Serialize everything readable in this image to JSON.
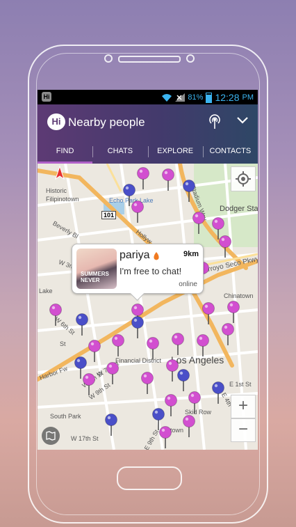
{
  "status_bar": {
    "app_badge": "Hi",
    "battery_percent": "81%",
    "time": "12:28",
    "ampm": "PM"
  },
  "app_bar": {
    "logo_text": "Hi",
    "title": "Nearby people"
  },
  "tabs": [
    {
      "label": "FIND",
      "active": true
    },
    {
      "label": "CHATS",
      "active": false
    },
    {
      "label": "EXPLORE",
      "active": false
    },
    {
      "label": "CONTACTS",
      "active": false
    }
  ],
  "map": {
    "labels": {
      "historic_filipinotown": "Historic",
      "historic_filipinotown_2": "Filipinotown",
      "echo_park_lake": "Echo Park Lake",
      "stadium_way": "Stadium Way",
      "dodger_stadium": "Dodger Stadi",
      "beverly": "Beverly Bl",
      "hollywood_fwy": "Hollyw",
      "w3rd": "W 3rd",
      "arroyo_seco": "Arroyo Seco Pkwy",
      "chinatown": "Chinatown",
      "lake": "Lake",
      "w6th": "W 6th St",
      "financial_district": "Financial District",
      "los_angeles": "Los Angeles",
      "harbor_fwy": "Harbor Fw",
      "w7th": "W 7th St",
      "w8th": "W 8th St",
      "w9th": "W 9th St",
      "e1st": "E 1st St",
      "skid_row": "Skid Row",
      "south_park": "South Park",
      "e4th": "E 4th",
      "e9th": "E 9th St",
      "w17th": "W 17th St",
      "ntown": "ntown",
      "st": "St",
      "route_101": "101"
    },
    "pin_colors": {
      "pink": "#d24fd0",
      "blue": "#4a4fc8"
    },
    "zoom_in": "+",
    "zoom_out": "−"
  },
  "popup": {
    "name": "pariya",
    "distance": "9km",
    "message": "I'm free to chat!",
    "status": "online",
    "thumb_text": "SUMMERS NEVER"
  }
}
